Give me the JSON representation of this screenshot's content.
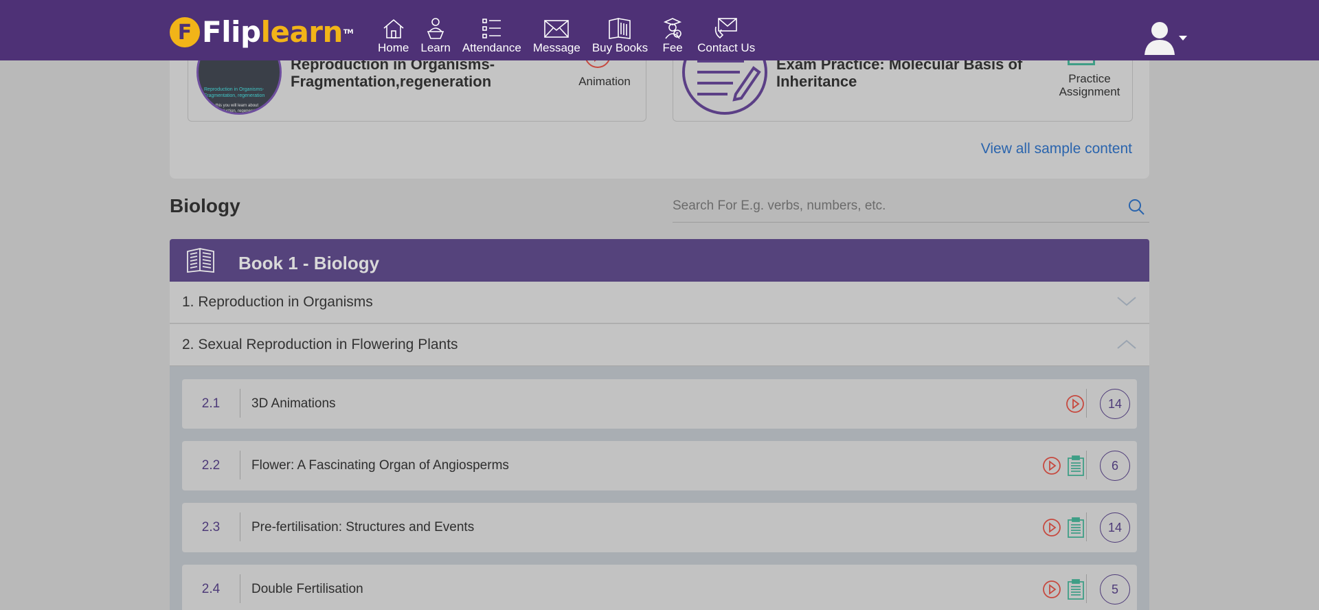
{
  "brand": {
    "logo_letter": "F",
    "name_part1": "Flip",
    "name_part2": "learn",
    "trademark": "TM"
  },
  "nav": [
    {
      "label": "Home",
      "icon": "home-icon"
    },
    {
      "label": "Learn",
      "icon": "learn-icon"
    },
    {
      "label": "Attendance",
      "icon": "attendance-icon"
    },
    {
      "label": "Message",
      "icon": "message-icon"
    },
    {
      "label": "Buy Books",
      "icon": "books-icon"
    },
    {
      "label": "Fee",
      "icon": "fee-icon"
    },
    {
      "label": "Contact Us",
      "icon": "contact-icon"
    }
  ],
  "sample": {
    "cards": [
      {
        "title": "Reproduction in Organisms-Fragmentation,regeneration",
        "type": "Animation",
        "thumb_text": "Reproduction in Organisms- Fragmentation, regeneration",
        "thumb_sub": "In this you will learn about Reproduction, regeneration"
      },
      {
        "title": "Exam Practice: Molecular Basis of Inheritance",
        "type": "Practice Assignment"
      }
    ],
    "view_all": "View all sample content"
  },
  "subject": {
    "title": "Biology"
  },
  "search": {
    "placeholder": "Search For E.g. verbs, numbers, etc."
  },
  "book": {
    "title": "Book 1 - Biology"
  },
  "chapters": [
    {
      "label": "1. Reproduction in Organisms",
      "expanded": false
    },
    {
      "label": "2. Sexual Reproduction in Flowering Plants",
      "expanded": true
    }
  ],
  "topics": [
    {
      "num": "2.1",
      "title": "3D Animations",
      "count": "14",
      "icons": [
        "play-icon"
      ]
    },
    {
      "num": "2.2",
      "title": "Flower: A Fascinating Organ of Angiosperms",
      "count": "6",
      "icons": [
        "play-icon",
        "assignment-icon"
      ]
    },
    {
      "num": "2.3",
      "title": "Pre-fertilisation: Structures and Events",
      "count": "14",
      "icons": [
        "play-icon",
        "assignment-icon"
      ]
    },
    {
      "num": "2.4",
      "title": "Double Fertilisation",
      "count": "5",
      "icons": [
        "play-icon",
        "assignment-icon"
      ]
    }
  ],
  "colors": {
    "brand_purple": "#4e3176",
    "brand_yellow": "#f2b418",
    "play_red": "#c6493f",
    "assignment_green": "#3f9e86",
    "link_blue": "#2a64ad"
  }
}
